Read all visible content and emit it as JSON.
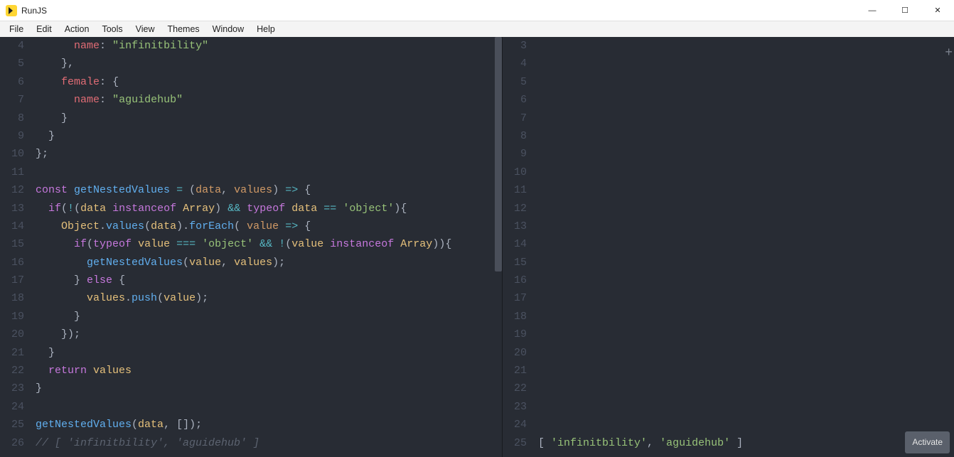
{
  "app": {
    "title": "RunJS"
  },
  "menu": {
    "items": [
      "File",
      "Edit",
      "Action",
      "Tools",
      "View",
      "Themes",
      "Window",
      "Help"
    ]
  },
  "window_controls": {
    "minimize": "—",
    "maximize": "☐",
    "close": "✕"
  },
  "left_editor": {
    "line_numbers": [
      "4",
      "5",
      "6",
      "7",
      "8",
      "9",
      "10",
      "11",
      "12",
      "13",
      "14",
      "15",
      "16",
      "17",
      "18",
      "19",
      "20",
      "21",
      "22",
      "23",
      "24",
      "25",
      "26"
    ],
    "lines": [
      {
        "html": "      <span class='c-prop'>name</span><span class='c-punc'>:</span> <span class='c-str'>\"infinitbility\"</span>"
      },
      {
        "html": "    <span class='c-punc'>},</span>"
      },
      {
        "html": "    <span class='c-prop'>female</span><span class='c-punc'>:</span> <span class='c-punc'>{</span>"
      },
      {
        "html": "      <span class='c-prop'>name</span><span class='c-punc'>:</span> <span class='c-str'>\"aguidehub\"</span>"
      },
      {
        "html": "    <span class='c-punc'>}</span>"
      },
      {
        "html": "  <span class='c-punc'>}</span>"
      },
      {
        "html": "<span class='c-punc'>};</span>"
      },
      {
        "html": ""
      },
      {
        "html": "<span class='c-key'>const</span> <span class='c-fn'>getNestedValues</span> <span class='c-op'>=</span> <span class='c-punc'>(</span><span class='c-param'>data</span><span class='c-punc'>,</span> <span class='c-param'>values</span><span class='c-punc'>)</span> <span class='c-op'>=&gt;</span> <span class='c-punc'>{</span>"
      },
      {
        "html": "  <span class='c-key'>if</span><span class='c-punc'>(</span><span class='c-op'>!</span><span class='c-punc'>(</span><span class='c-var'>data</span> <span class='c-key'>instanceof</span> <span class='c-var'>Array</span><span class='c-punc'>)</span> <span class='c-op'>&amp;&amp;</span> <span class='c-key'>typeof</span> <span class='c-var'>data</span> <span class='c-op'>==</span> <span class='c-str'>'object'</span><span class='c-punc'>){</span>"
      },
      {
        "html": "    <span class='c-var'>Object</span><span class='c-punc'>.</span><span class='c-fn'>values</span><span class='c-punc'>(</span><span class='c-var'>data</span><span class='c-punc'>).</span><span class='c-fn'>forEach</span><span class='c-punc'>(</span> <span class='c-param'>value</span> <span class='c-op'>=&gt;</span> <span class='c-punc'>{</span>"
      },
      {
        "html": "      <span class='c-key'>if</span><span class='c-punc'>(</span><span class='c-key'>typeof</span> <span class='c-var'>value</span> <span class='c-op'>===</span> <span class='c-str'>'object'</span> <span class='c-op'>&amp;&amp;</span> <span class='c-op'>!</span><span class='c-punc'>(</span><span class='c-var'>value</span> <span class='c-key'>instanceof</span> <span class='c-var'>Array</span><span class='c-punc'>)){</span>"
      },
      {
        "html": "        <span class='c-fn'>getNestedValues</span><span class='c-punc'>(</span><span class='c-var'>value</span><span class='c-punc'>,</span> <span class='c-var'>values</span><span class='c-punc'>);</span>"
      },
      {
        "html": "      <span class='c-punc'>}</span> <span class='c-key'>else</span> <span class='c-punc'>{</span>"
      },
      {
        "html": "        <span class='c-var'>values</span><span class='c-punc'>.</span><span class='c-fn'>push</span><span class='c-punc'>(</span><span class='c-var'>value</span><span class='c-punc'>);</span>"
      },
      {
        "html": "      <span class='c-punc'>}</span>"
      },
      {
        "html": "    <span class='c-punc'>});</span>"
      },
      {
        "html": "  <span class='c-punc'>}</span>"
      },
      {
        "html": "  <span class='c-key'>return</span> <span class='c-var'>values</span>"
      },
      {
        "html": "<span class='c-punc'>}</span>"
      },
      {
        "html": ""
      },
      {
        "html": "<span class='c-fn'>getNestedValues</span><span class='c-punc'>(</span><span class='c-var'>data</span><span class='c-punc'>,</span> <span class='c-punc'>[]);</span>"
      },
      {
        "html": "<span class='c-cmt'>// [ 'infinitbility', 'aguidehub' ]</span>"
      }
    ]
  },
  "right_output": {
    "line_numbers": [
      "3",
      "4",
      "5",
      "6",
      "7",
      "8",
      "9",
      "10",
      "11",
      "12",
      "13",
      "14",
      "15",
      "16",
      "17",
      "18",
      "19",
      "20",
      "21",
      "22",
      "23",
      "24",
      "25"
    ],
    "lines": [
      {
        "html": ""
      },
      {
        "html": ""
      },
      {
        "html": ""
      },
      {
        "html": ""
      },
      {
        "html": ""
      },
      {
        "html": ""
      },
      {
        "html": ""
      },
      {
        "html": ""
      },
      {
        "html": ""
      },
      {
        "html": ""
      },
      {
        "html": ""
      },
      {
        "html": ""
      },
      {
        "html": ""
      },
      {
        "html": ""
      },
      {
        "html": ""
      },
      {
        "html": ""
      },
      {
        "html": ""
      },
      {
        "html": ""
      },
      {
        "html": ""
      },
      {
        "html": ""
      },
      {
        "html": ""
      },
      {
        "html": ""
      },
      {
        "html": "<span class='c-punc'>[ </span><span class='c-str'>'infinitbility'</span><span class='c-punc'>, </span><span class='c-str'>'aguidehub'</span><span class='c-punc'> ]</span>"
      }
    ]
  },
  "activate_label": "Activate",
  "add_tab_glyph": "+"
}
